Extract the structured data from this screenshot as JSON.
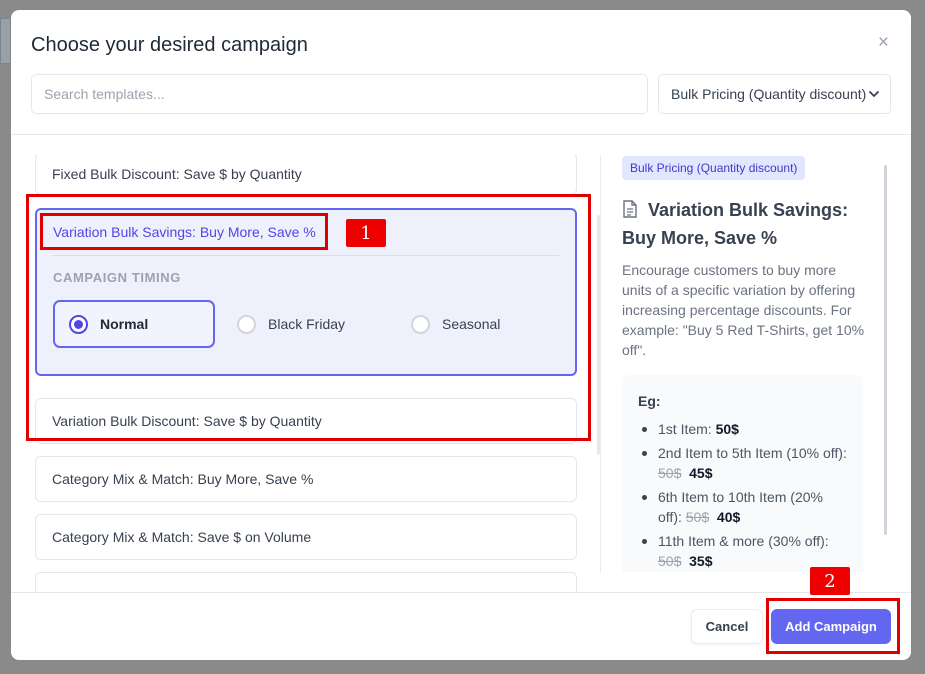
{
  "modal": {
    "title": "Choose your desired campaign",
    "close_glyph": "×"
  },
  "search": {
    "placeholder": "Search templates..."
  },
  "filter": {
    "selected": "Bulk Pricing (Quantity discount)",
    "icon": "chevron-down-icon"
  },
  "templates": [
    {
      "title": "Fixed Bulk Discount: Save $ by Quantity"
    },
    {
      "title": "Variation Bulk Savings: Buy More, Save %",
      "active": true
    },
    {
      "title": "Variation Bulk Discount: Save $ by Quantity"
    },
    {
      "title": "Category Mix & Match: Buy More, Save %"
    },
    {
      "title": "Category Mix & Match: Save $ on Volume"
    },
    {
      "title": ""
    }
  ],
  "timing": {
    "label": "CAMPAIGN TIMING",
    "options": [
      "Normal",
      "Black Friday",
      "Seasonal"
    ],
    "selected": "Normal"
  },
  "detail": {
    "badge": "Bulk Pricing (Quantity discount)",
    "title": "Variation Bulk Savings: Buy More, Save %",
    "icon": "document-icon",
    "description": "Encourage customers to buy more units of a specific variation by offering increasing percentage discounts. For example: \"Buy 5 Red T-Shirts, get 10% off\".",
    "example_label": "Eg:",
    "examples": [
      {
        "label": "1st Item:",
        "old": "",
        "price": "50$"
      },
      {
        "label": "2nd Item to 5th Item (10% off):",
        "old": "50$",
        "price": "45$"
      },
      {
        "label": "6th Item to 10th Item (20% off):",
        "old": "50$",
        "price": "40$"
      },
      {
        "label": "11th Item & more (30% off):",
        "old": "50$",
        "price": "35$"
      }
    ]
  },
  "footer": {
    "cancel_label": "Cancel",
    "add_label": "Add Campaign"
  },
  "annotations": {
    "marker_1": "1",
    "marker_2": "2",
    "color": "#e00000"
  },
  "colors": {
    "accent": "#6366f1",
    "accent_text": "#4f46e5"
  }
}
